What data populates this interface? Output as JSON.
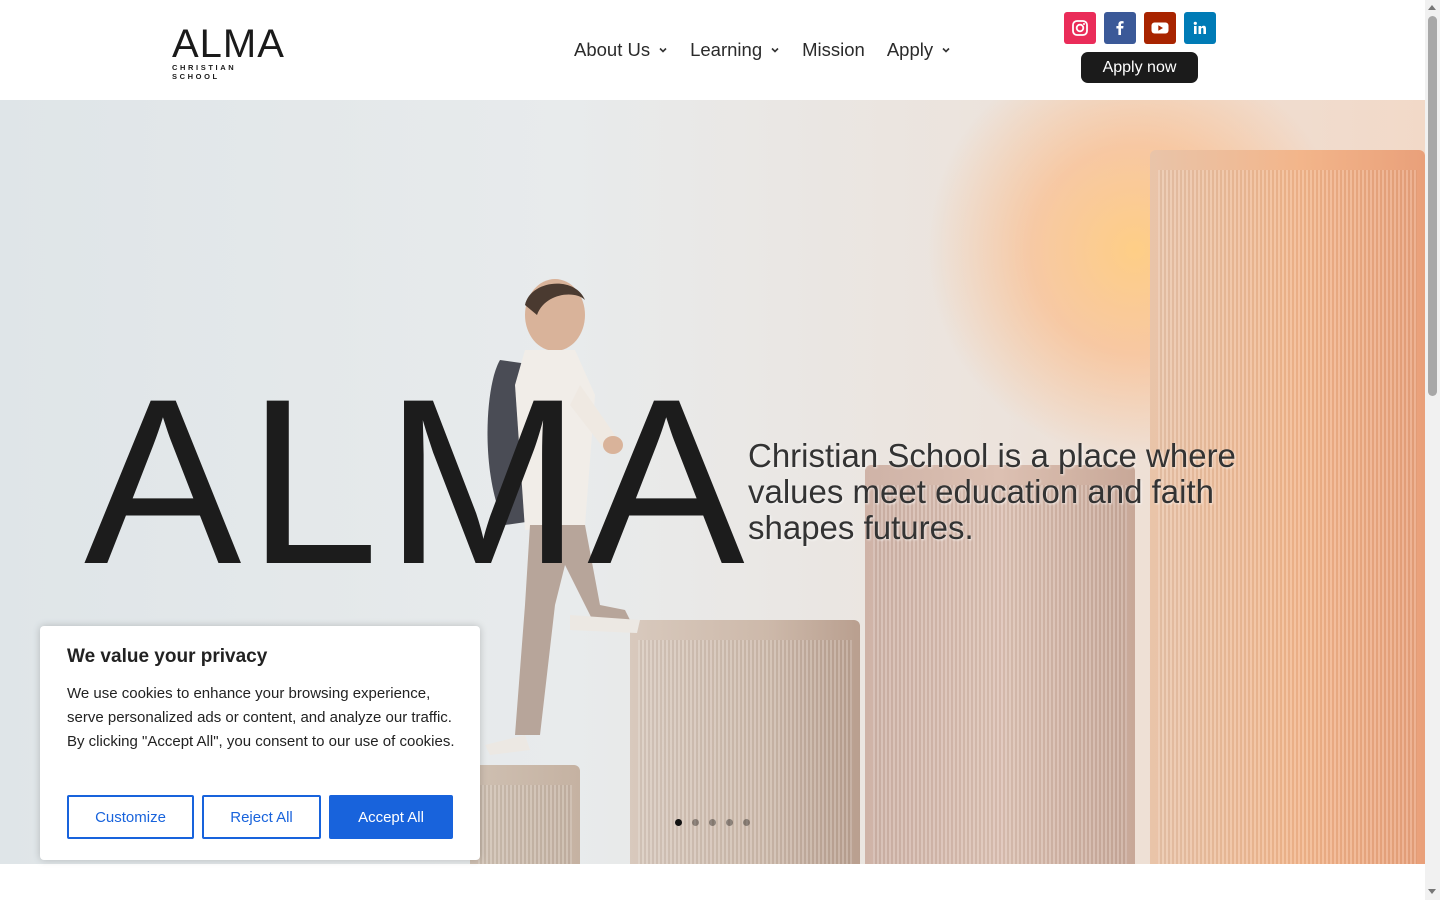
{
  "header": {
    "logo": {
      "word": "ALMA",
      "subtitle": "CHRISTIAN SCHOOL"
    },
    "nav": [
      {
        "label": "About Us",
        "has_dropdown": true
      },
      {
        "label": "Learning",
        "has_dropdown": true
      },
      {
        "label": "Mission",
        "has_dropdown": false
      },
      {
        "label": "Apply",
        "has_dropdown": true
      }
    ],
    "socials": [
      {
        "icon": "instagram-icon",
        "color": "#ea2c59"
      },
      {
        "icon": "facebook-icon",
        "color": "#3b5998"
      },
      {
        "icon": "youtube-icon",
        "color": "#a82400"
      },
      {
        "icon": "linkedin-icon",
        "color": "#007bb6"
      }
    ],
    "apply_now_label": "Apply now"
  },
  "hero": {
    "logo_word": "ALMA",
    "tagline": "Christian School is a place where values meet education and faith shapes futures.",
    "slide_count": 5,
    "active_slide": 1
  },
  "cookie_banner": {
    "title": "We value your privacy",
    "body": "We use cookies to enhance your browsing experience, serve personalized ads or content, and analyze our traffic. By clicking \"Accept All\", you consent to our use of cookies.",
    "customize_label": "Customize",
    "reject_label": "Reject All",
    "accept_label": "Accept All"
  },
  "colors": {
    "accent": "#1863dc",
    "dark": "#1b1b1b"
  }
}
